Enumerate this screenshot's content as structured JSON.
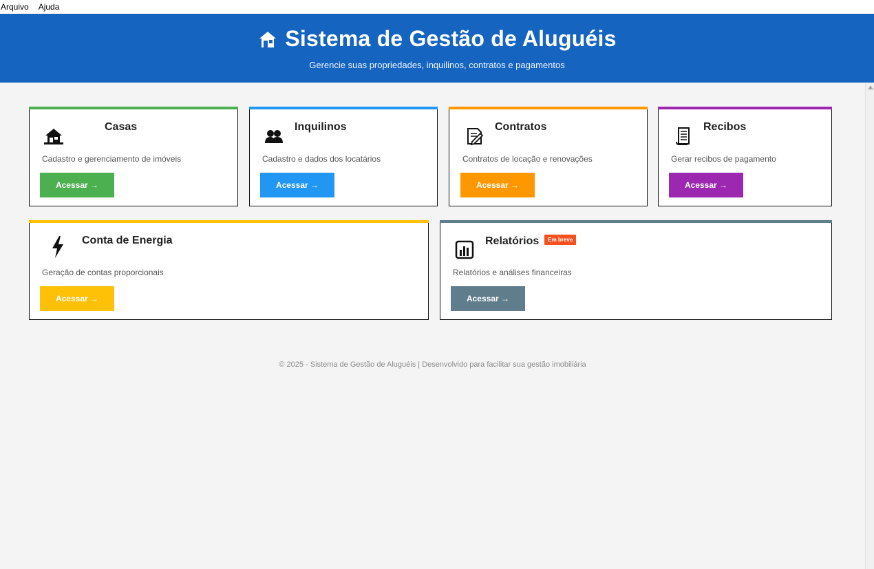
{
  "menu": {
    "items": [
      "Arquivo",
      "Ajuda"
    ]
  },
  "header": {
    "title": "Sistema de Gestão de Aluguéis",
    "subtitle": "Gerencie suas propriedades, inquilinos, contratos e pagamentos",
    "bg_color": "#1565c0"
  },
  "cards": [
    {
      "title": "Casas",
      "description": "Cadastro e gerenciamento de imóveis",
      "button": "Acessar →",
      "color": "#4caf50",
      "icon": "house-icon"
    },
    {
      "title": "Inquilinos",
      "description": "Cadastro e dados dos locatários",
      "button": "Acessar →",
      "color": "#2196f3",
      "icon": "people-icon"
    },
    {
      "title": "Contratos",
      "description": "Contratos de locação e renovações",
      "button": "Acessar →",
      "color": "#ff9800",
      "icon": "contract-icon"
    },
    {
      "title": "Recibos",
      "description": "Gerar recibos de pagamento",
      "button": "Acessar →",
      "color": "#9c27b0",
      "icon": "receipt-icon"
    },
    {
      "title": "Conta de Energia",
      "description": "Geração de contas proporcionais",
      "button": "Acessar →",
      "color": "#ffc107",
      "icon": "lightning-icon"
    },
    {
      "title": "Relatórios",
      "badge": "Em breve",
      "description": "Relatórios e análises financeiras",
      "button": "Acessar →",
      "color": "#607d8b",
      "icon": "bar-chart-icon"
    }
  ],
  "footer": {
    "text": "© 2025 - Sistema de Gestão de Aluguéis | Desenvolvido para facilitar sua gestão imobiliária"
  }
}
